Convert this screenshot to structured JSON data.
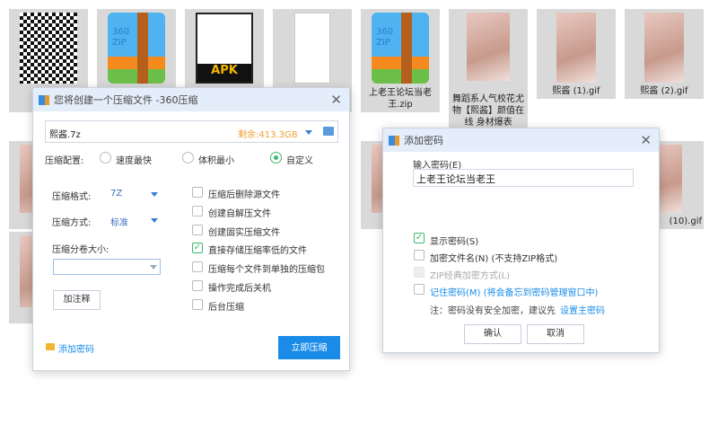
{
  "desktop": {
    "files": [
      {
        "label": "",
        "kind": "qr"
      },
      {
        "label": "",
        "kind": "zip"
      },
      {
        "label": "",
        "kind": "apk"
      },
      {
        "label": "",
        "kind": "doc"
      },
      {
        "label": "上老王论坛当老王.zip",
        "kind": "zip"
      },
      {
        "label": "舞蹈系人气校花尤物【熙酱】颜值在线 身材爆表",
        "kind": "video"
      },
      {
        "label": "熙酱 (1).gif",
        "kind": "photo"
      },
      {
        "label": "熙酱 (2).gif",
        "kind": "photo"
      },
      {
        "label": "(10).gif",
        "kind": "photo"
      }
    ],
    "apk_text": "APK",
    "zip_text": "360 ZIP"
  },
  "compress": {
    "title": "您将创建一个压缩文件 -360压缩",
    "filename": "熙酱.7z",
    "free_space": "剩余:413.3GB",
    "config_label": "压缩配置:",
    "presets": [
      {
        "label": "速度最快",
        "selected": false
      },
      {
        "label": "体积最小",
        "selected": false
      },
      {
        "label": "自定义",
        "selected": true
      }
    ],
    "format_label": "压缩格式:",
    "format_value": "7Z",
    "method_label": "压缩方式:",
    "method_value": "标准",
    "split_label": "压缩分卷大小:",
    "split_value": "",
    "comment_button": "加注释",
    "options": [
      {
        "label": "压缩后删除源文件",
        "checked": false
      },
      {
        "label": "创建自解压文件",
        "checked": false
      },
      {
        "label": "创建固实压缩文件",
        "checked": false
      },
      {
        "label": "直接存储压缩率低的文件",
        "checked": true
      },
      {
        "label": "压缩每个文件到单独的压缩包",
        "checked": false
      },
      {
        "label": "操作完成后关机",
        "checked": false
      },
      {
        "label": "后台压缩",
        "checked": false
      }
    ],
    "add_password": "添加密码",
    "compress_now": "立即压缩",
    "accent": "#1a8ce8"
  },
  "password": {
    "title": "添加密码",
    "input_label": "输入密码(E)",
    "input_value": "上老王论坛当老王",
    "options": [
      {
        "label": "显示密码(S)",
        "checked": true,
        "disabled": false
      },
      {
        "label": "加密文件名(N) (不支持ZIP格式)",
        "checked": false,
        "disabled": false
      },
      {
        "label": "ZIP经典加密方式(L)",
        "checked": false,
        "disabled": true
      },
      {
        "label": "记住密码(M) (将会备忘到密码管理窗口中)",
        "checked": false,
        "disabled": false
      }
    ],
    "note": "注：密码没有安全加密，建议先",
    "note_link": "设置主密码",
    "ok": "确认",
    "cancel": "取消"
  }
}
